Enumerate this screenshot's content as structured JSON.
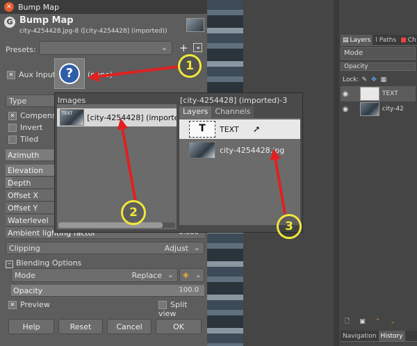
{
  "dialog": {
    "window_title": "Bump Map",
    "header_title": "Bump Map",
    "header_subtitle": "city-4254428.jpg-8 ([city-4254428] (imported))",
    "presets_label": "Presets:",
    "presets_value": "",
    "aux_input_label": "Aux Input",
    "aux_input_hint": "(none)",
    "type_label": "Type",
    "compensate_label": "Compensate",
    "invert_label": "Invert",
    "tiled_label": "Tiled",
    "azimuth_label": "Azimuth",
    "elevation_label": "Elevation",
    "depth_label": "Depth",
    "offset_x_label": "Offset X",
    "offset_y_label": "Offset Y",
    "waterlevel_label": "Waterlevel",
    "ambient_label": "Ambient lighting factor",
    "ambient_value": "0.000",
    "clipping_label": "Clipping",
    "clipping_value": "Adjust",
    "blending_label": "Blending Options",
    "mode_label": "Mode",
    "mode_value": "Replace",
    "opacity_label": "Opacity",
    "opacity_value": "100.0",
    "opacity_percent": 100,
    "preview_label": "Preview",
    "split_view_label": "Split view",
    "help_label": "Help",
    "reset_label": "Reset",
    "cancel_label": "Cancel",
    "ok_label": "OK"
  },
  "popup": {
    "images_header": "Images",
    "image_item": "[city-4254428] (imported",
    "layers_header": "[city-4254428] (imported)-3",
    "tab_layers": "Layers",
    "tab_channels": "Channels",
    "layer_items": [
      "TEXT",
      "city-4254428.jpg"
    ],
    "thumb_text": "TEXT"
  },
  "dock": {
    "tabs": [
      "Layers",
      "Paths",
      "Ch"
    ],
    "mode_label": "Mode",
    "opacity_label": "Opacity",
    "lock_label": "Lock:",
    "layers": [
      "TEXT",
      "city-42"
    ],
    "bottom_tabs": [
      "Navigation",
      "History"
    ]
  },
  "annotations": [
    "1",
    "2",
    "3"
  ],
  "colors": {
    "annotation_yellow": "#f2e83a",
    "arrow_red": "#e02020",
    "dialog_bg": "#5d5d5d"
  }
}
